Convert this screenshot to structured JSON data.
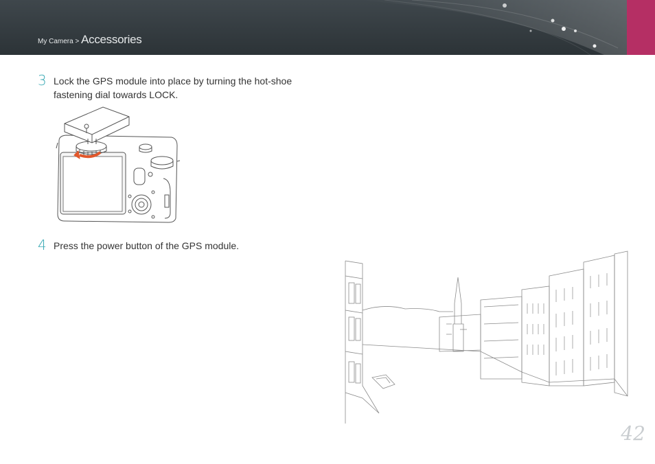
{
  "header": {
    "breadcrumb_parent": "My Camera",
    "breadcrumb_separator": " > ",
    "breadcrumb_current": "Accessories",
    "accent_color": "#b52f64",
    "background_color": "#353c40"
  },
  "steps": [
    {
      "number": "3",
      "text": "Lock the GPS module into place by turning the hot-shoe fastening dial towards LOCK."
    },
    {
      "number": "4",
      "text": "Press the power button of the GPS module."
    }
  ],
  "page_number": "42",
  "colors": {
    "step_number": "#37a8b3",
    "arrow": "#e2572b"
  }
}
